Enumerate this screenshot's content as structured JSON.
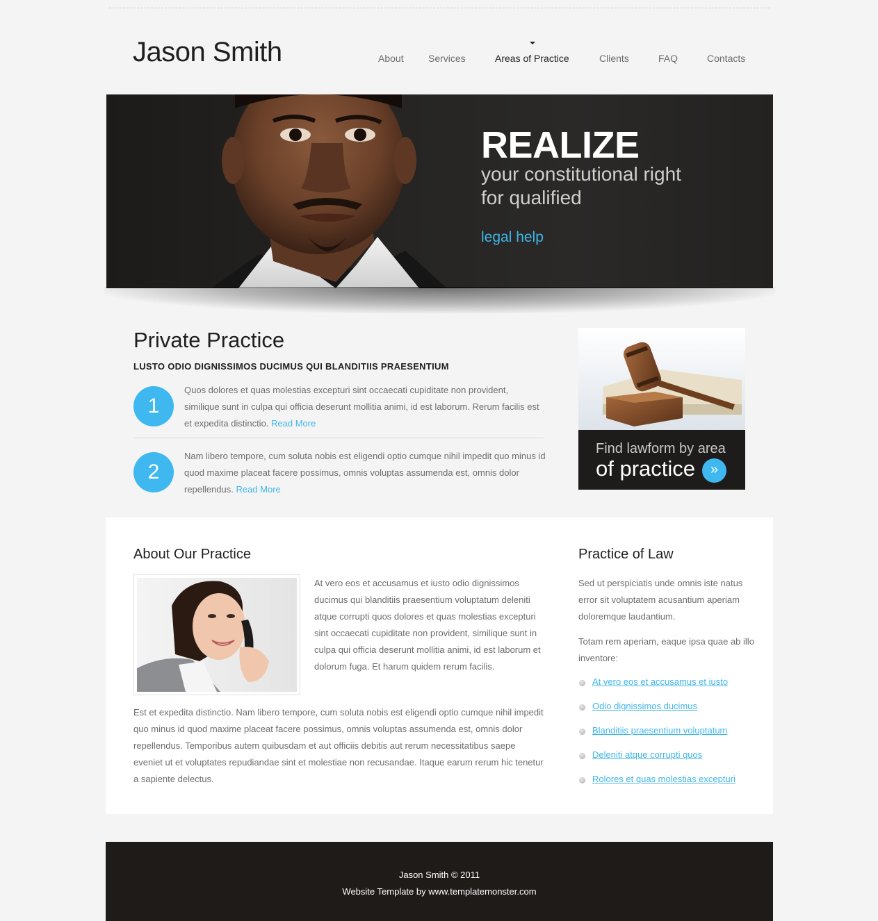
{
  "site": {
    "logo": "Jason Smith"
  },
  "nav": {
    "items": [
      {
        "label": "About"
      },
      {
        "label": "Services"
      },
      {
        "label": "Areas of Practice",
        "active": true
      },
      {
        "label": "Clients"
      },
      {
        "label": "FAQ"
      },
      {
        "label": "Contacts"
      }
    ]
  },
  "banner": {
    "headline": "REALIZE",
    "subline_1": "your constitutional right",
    "subline_2": "for qualified",
    "link": "legal help"
  },
  "private_practice": {
    "title": "Private Practice",
    "subtitle": "LUSTO ODIO DIGNISSIMOS DUCIMUS QUI BLANDITIIS PRAESENTIUM",
    "items": [
      {
        "number": "1",
        "text": "Quos dolores et quas molestias excepturi sint occaecati cupiditate non provident, similique sunt in culpa qui officia deserunt mollitia animi, id est laborum. Rerum facilis est et expedita distinctio.",
        "link": "Read More"
      },
      {
        "number": "2",
        "text": "Nam libero tempore, cum soluta nobis est eligendi optio cumque nihil impedit quo minus id quod maxime placeat facere possimus, omnis voluptas assumenda est, omnis dolor repellendus.",
        "link": "Read More"
      }
    ]
  },
  "lawform": {
    "line_1": "Find lawform by area",
    "line_2": "of practice",
    "button_icon": "double-chevron-right-icon"
  },
  "about": {
    "title": "About Our Practice",
    "paragraph_1": "At vero eos et accusamus et iusto odio dignissimos ducimus qui blanditiis praesentium voluptatum deleniti atque corrupti quos dolores et quas molestias excepturi sint occaecati cupiditate non provident, similique sunt in culpa qui officia deserunt mollitia animi, id est laborum et dolorum fuga. Et harum quidem rerum facilis.",
    "paragraph_2": "Est et expedita distinctio. Nam libero tempore, cum soluta nobis est eligendi optio cumque nihil impedit quo minus id quod maxime placeat facere possimus, omnis voluptas assumenda est, omnis dolor repellendus. Temporibus autem quibusdam et aut officiis debitis aut rerum necessitatibus saepe eveniet ut et voluptates repudiandae sint et molestiae non recusandae. Itaque earum rerum hic tenetur a sapiente delectus."
  },
  "practice_of_law": {
    "title": "Practice of Law",
    "paragraph_1": "Sed ut perspiciatis unde omnis iste natus error sit voluptatem acusantium aperiam doloremque laudantium.",
    "paragraph_2": "Totam rem aperiam, eaque ipsa quae ab illo inventore:",
    "links": [
      "At vero eos et accusamus et iusto",
      "Odio dignissimos ducimus",
      "Blanditiis praesentium voluptatum",
      "Deleniti atque corrupti quos",
      "Rolores et quas molestias excepturi"
    ]
  },
  "footer": {
    "line_1": "Jason Smith © 2011",
    "line_2": "Website Template by www.templatemonster.com"
  },
  "colors": {
    "accent": "#3fb8ef",
    "background": "#f4f4f4",
    "banner": "#262523",
    "footer": "#1f1b19"
  }
}
